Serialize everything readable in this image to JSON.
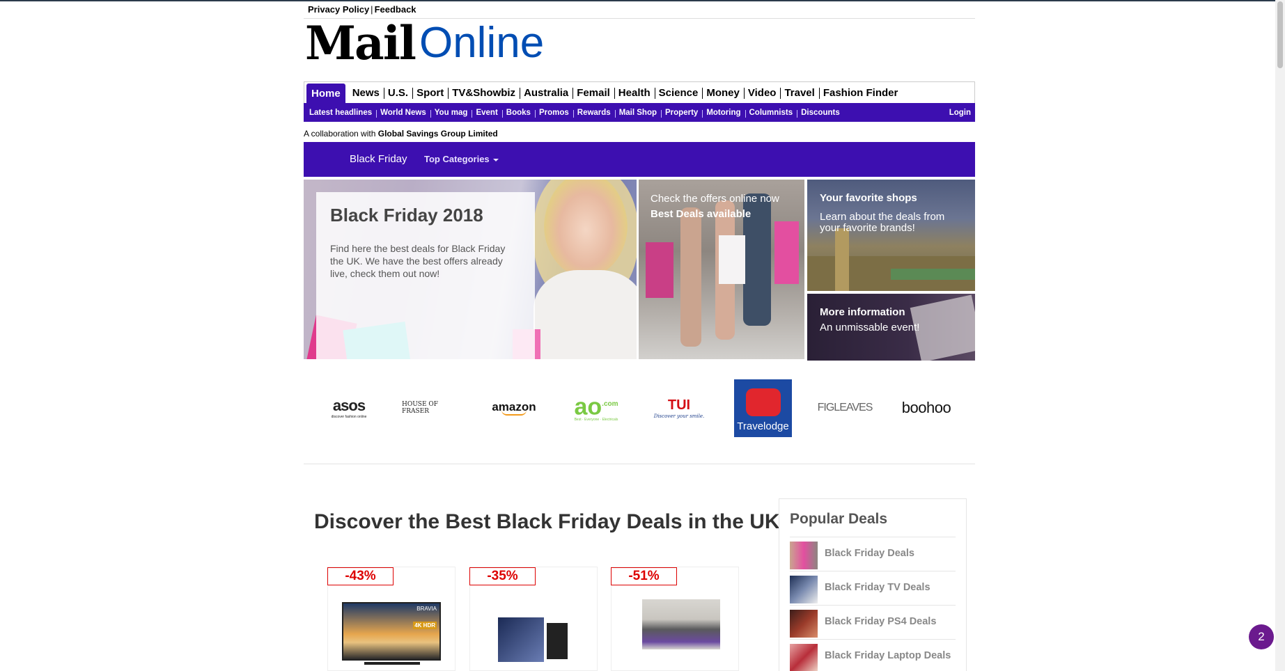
{
  "top_links": {
    "privacy": "Privacy Policy",
    "separator": "|",
    "feedback": "Feedback"
  },
  "logo": {
    "mail": "Mail",
    "online": "Online"
  },
  "main_nav": [
    "Home",
    "News",
    "U.S.",
    "Sport",
    "TV&Showbiz",
    "Australia",
    "Femail",
    "Health",
    "Science",
    "Money",
    "Video",
    "Travel",
    "Fashion Finder"
  ],
  "sub_nav": [
    "Latest headlines",
    "World News",
    "You mag",
    "Event",
    "Books",
    "Promos",
    "Rewards",
    "Mail Shop",
    "Property",
    "Motoring",
    "Columnists",
    "Discounts"
  ],
  "login": "Login",
  "collab": {
    "prefix": "A collaboration with ",
    "partner": "Global Savings Group Limited"
  },
  "purple_bar": {
    "black_friday": "Black Friday",
    "top_categories": "Top Categories"
  },
  "hero": {
    "title": "Black Friday 2018",
    "text": "Find here the best deals for Black Friday the UK. We have the best offers already live, check them out now!",
    "mid_line1": "Check the offers online now",
    "mid_line2": "Best Deals available",
    "shops_title": "Your favorite shops",
    "shops_text": "Learn about the deals from your favorite brands!",
    "info_title": "More information",
    "info_text": "An unmissable event!"
  },
  "brands": {
    "asos": "asos",
    "asos_tag": "discover fashion online",
    "house_of_fraser": "HOUSE OF FRASER",
    "amazon": "amazon",
    "ao": "ao",
    "ao_com": ".com",
    "ao_tag": "Best · Everyone · Electricals",
    "tui": "TUI",
    "tui_tag": "Discover your smile.",
    "travelodge": "Travelodge",
    "figleaves": "FIGLEAVES",
    "boohoo": "boohoo"
  },
  "discover_heading": "Discover the Best Black Friday Deals in the UK",
  "deals": [
    {
      "badge": "-43%",
      "tv_brand": "BRAVIA",
      "tv_tag": "4K HDR"
    },
    {
      "badge": "-35%"
    },
    {
      "badge": "-51%"
    }
  ],
  "popular": {
    "title": "Popular Deals",
    "items": [
      "Black Friday Deals",
      "Black Friday TV Deals",
      "Black Friday PS4 Deals",
      "Black Friday Laptop Deals"
    ]
  },
  "notification_count": "2",
  "colors": {
    "brand_purple": "#3d0fb0",
    "deal_red": "#d00000",
    "logo_blue": "#004db3"
  }
}
